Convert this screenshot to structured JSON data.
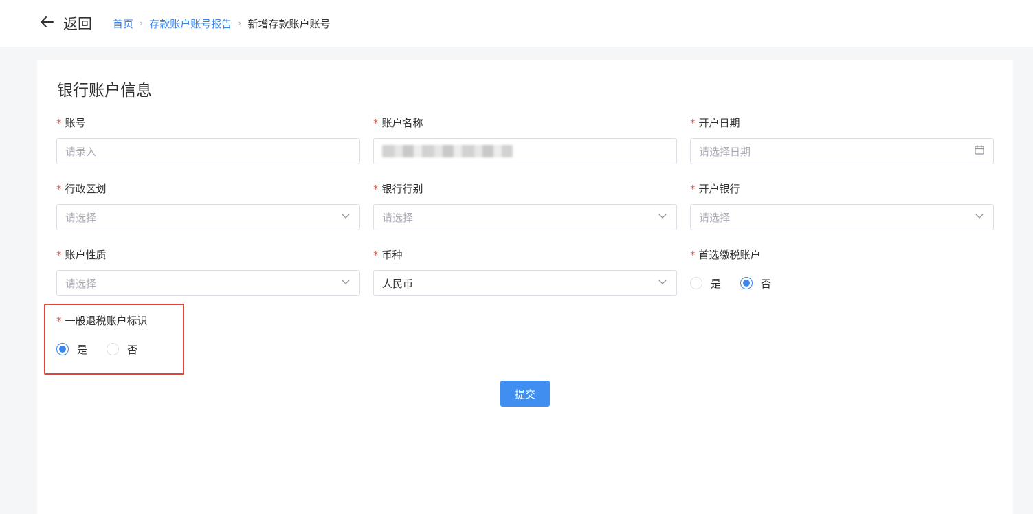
{
  "header": {
    "back_label": "返回",
    "breadcrumb": [
      "首页",
      "存款账户账号报告",
      "新增存款账户账号"
    ]
  },
  "section_title": "银行账户信息",
  "fields": {
    "account_no": {
      "label": "账号",
      "placeholder": "请录入"
    },
    "account_name": {
      "label": "账户名称"
    },
    "open_date": {
      "label": "开户日期",
      "placeholder": "请选择日期"
    },
    "region": {
      "label": "行政区划",
      "placeholder": "请选择"
    },
    "bank_type": {
      "label": "银行行别",
      "placeholder": "请选择"
    },
    "open_bank": {
      "label": "开户银行",
      "placeholder": "请选择"
    },
    "account_nature": {
      "label": "账户性质",
      "placeholder": "请选择"
    },
    "currency": {
      "label": "币种",
      "value": "人民币"
    },
    "preferred_tax": {
      "label": "首选缴税账户",
      "options": [
        "是",
        "否"
      ],
      "selected": "否"
    },
    "refund_tax": {
      "label": "一般退税账户标识",
      "options": [
        "是",
        "否"
      ],
      "selected": "是"
    }
  },
  "required_mark": "*",
  "submit_label": "提交",
  "colors": {
    "primary": "#3a86e8",
    "required": "#e04a3f",
    "highlight": "#e0443a"
  }
}
